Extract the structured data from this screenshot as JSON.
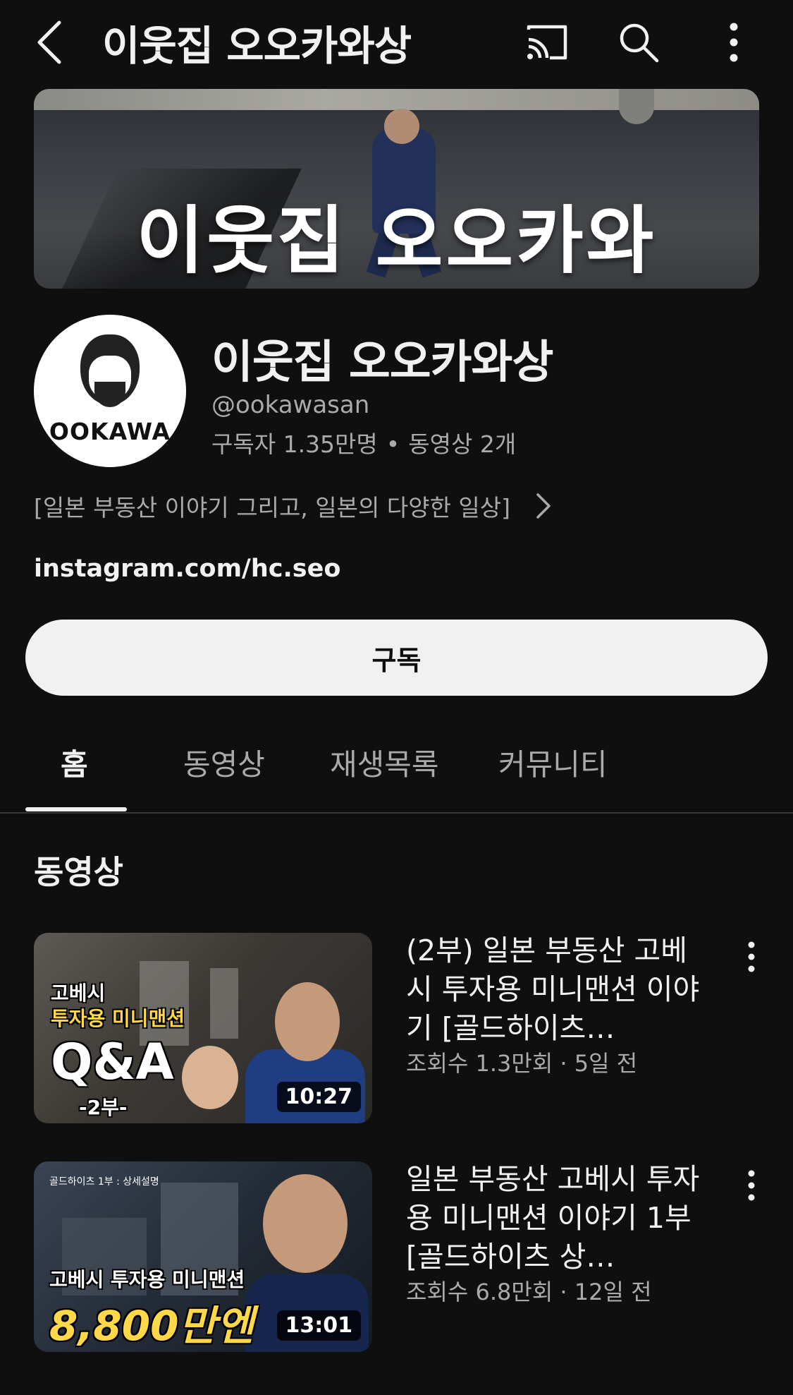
{
  "header": {
    "title": "이웃집 오오카와상",
    "icons": [
      "back-icon",
      "cast-icon",
      "search-icon",
      "more-vertical-icon"
    ]
  },
  "banner": {
    "text": "이웃집 오오카와"
  },
  "channel": {
    "avatar_text": "OOKAWA",
    "name": "이웃집 오오카와상",
    "handle": "@ookawasan",
    "subscribers": "구독자 1.35만명",
    "separator": "•",
    "video_count": "동영상 2개",
    "description": "[일본 부동산 이야기 그리고, 일본의 다양한 일상]",
    "link": "instagram.com/hc.seo",
    "subscribe_label": "구독"
  },
  "tabs": [
    {
      "label": "홈",
      "active": true
    },
    {
      "label": "동영상",
      "active": false
    },
    {
      "label": "재생목록",
      "active": false
    },
    {
      "label": "커뮤니티",
      "active": false
    }
  ],
  "section": {
    "title": "동영상"
  },
  "videos": [
    {
      "title": "(2부) 일본 부동산 고베시 투자용 미니맨션 이야기 [골드하이츠…",
      "meta": "조회수 1.3만회 · 5일 전",
      "duration": "10:27",
      "thumb_texts": [
        "고베시",
        "투자용 미니맨션",
        "Q&A",
        "-2부-"
      ]
    },
    {
      "title": "일본 부동산 고베시 투자용 미니맨션 이야기 1부 [골드하이츠 상…",
      "meta": "조회수 6.8만회 · 12일 전",
      "duration": "13:01",
      "thumb_texts": [
        "골드하이츠 1부 : 상세설명",
        "고베시 투자용 미니맨션",
        "8,800만엔"
      ]
    }
  ],
  "colors": {
    "background": "#0f0f0f",
    "text_primary": "#f1f1f1",
    "text_secondary": "#aaaaaa",
    "subscribe_bg": "#f1f1f1",
    "thumb_accent": "#ffd84a"
  }
}
